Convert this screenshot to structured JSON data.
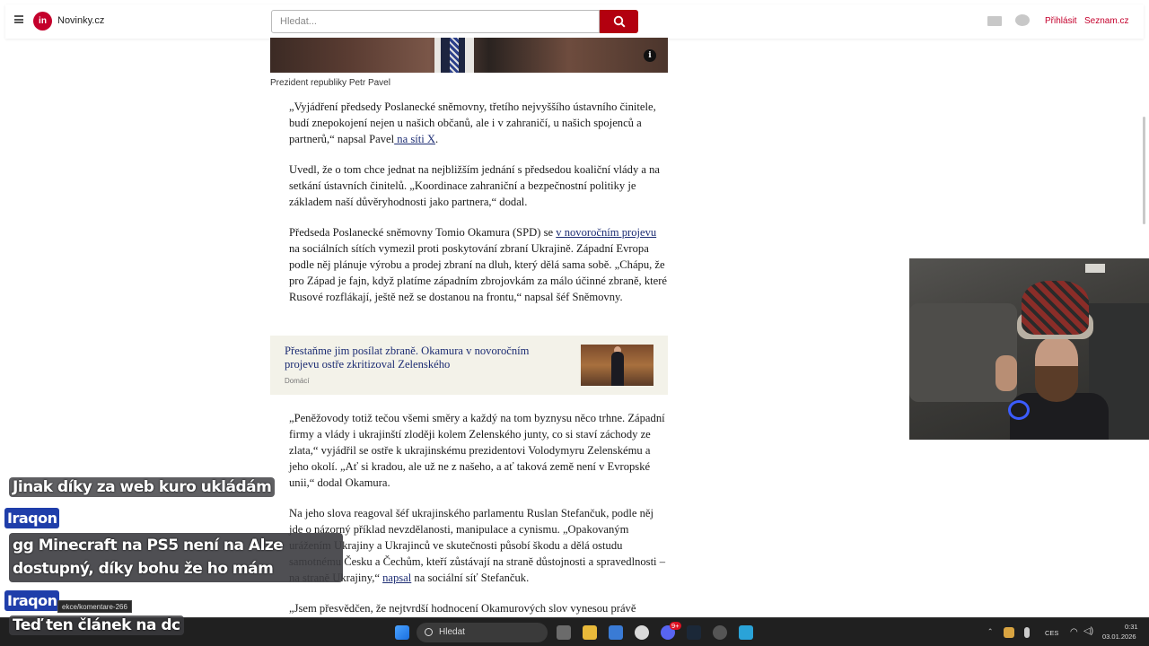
{
  "browser": {
    "site_name": "Novinky.cz",
    "logo_letters": "in",
    "search_placeholder": "Hledat...",
    "login_label": "Přihlásit",
    "seznam_label": "Seznam.cz",
    "status_url": "ekce/komentare-266"
  },
  "article": {
    "image_caption": "Prezident republiky Petr Pavel",
    "info_label": "i",
    "p1_text": "„Vyjádření předsedy Poslanecké sněmovny, třetího nejvyššího ústavního činitele, budí znepokojení nejen u našich občanů, ale i v zahraničí, u našich spojenců a partnerů,“ napsal Pavel",
    "p1_link": " na síti X",
    "p1_end": ".",
    "p2_text": "Uvedl, že o tom chce jednat na nejbližším jednání s předsedou koaliční vlády a na setkání ústavních činitelů. „Koordinace zahraniční a bezpečnostní politiky je základem naší důvěryhodnosti jako partnera,“ dodal.",
    "p3_start": "Předseda Poslanecké sněmovny Tomio Okamura (SPD) se ",
    "p3_link": "v novoročním projevu",
    "p3_end": " na sociálních sítích vymezil proti poskytování zbraní Ukrajině. Západní Evropa podle něj plánuje výrobu a prodej zbraní na dluh, který dělá sama sobě. „Chápu, že pro Západ je fajn, když platíme západním zbrojovkám za málo účinné zbraně, které Rusové rozflákají, ještě než se dostanou na frontu,“ napsal šéf Sněmovny.",
    "related_title": "Přestaňme jim posílat zbraně. Okamura v novoročním projevu ostře zkritizoval Zelenského",
    "related_category": "Domácí",
    "p4_text": "„Peněžovody totiž tečou všemi směry a každý na tom byznysu něco trhne. Západní firmy a vlády i ukrajinští zloději kolem Zelenského junty, co si staví záchody ze zlata,“ vyjádřil se ostře k ukrajinskému prezidentovi Volodymyru Zelenskému a jeho okolí. „Ať si kradou, ale už ne z našeho, a ať taková země není v Evropské unii,“ dodal Okamura.",
    "p5_start": "Na jeho slova reagoval šéf ukrajinského parlamentu Ruslan Stefančuk, podle něj jde o názorný příklad nevzdělanosti, manipulace a cynismu. „Opakovaným urážením Ukrajiny a Ukrajinců ve skutečnosti působí škodu a dělá ostudu samotnému Česku a Čechům, kteří zůstávají na straně důstojnosti a spravedlnosti – na straně Ukrajiny,“ ",
    "p5_link": "napsal",
    "p5_end": " na sociální síť Stefančuk.",
    "p6_text": "„Jsem přesvědčen, že nejtvrdší hodnocení Okamurových slov vynesou právě"
  },
  "chat": {
    "msg1": "Jinak díky za web kuro ukládám",
    "user1": "Iraqon",
    "msg2_line1": "gg Minecraft na PS5 není na Alze",
    "msg2_line2": "dostupný, díky bohu že ho mám",
    "user2": "Iraqon",
    "msg3": "Teď ten článek na dc"
  },
  "taskbar": {
    "search_label": "Hledat",
    "language": "CES",
    "time": "0:31",
    "date": "03.01.2026",
    "discord_badge": "9+"
  },
  "colors": {
    "brand_red": "#c4002c",
    "link_blue": "#1c2c73",
    "related_bg": "#f3f2e9",
    "chat_user_bg": "#1f3eaa"
  }
}
